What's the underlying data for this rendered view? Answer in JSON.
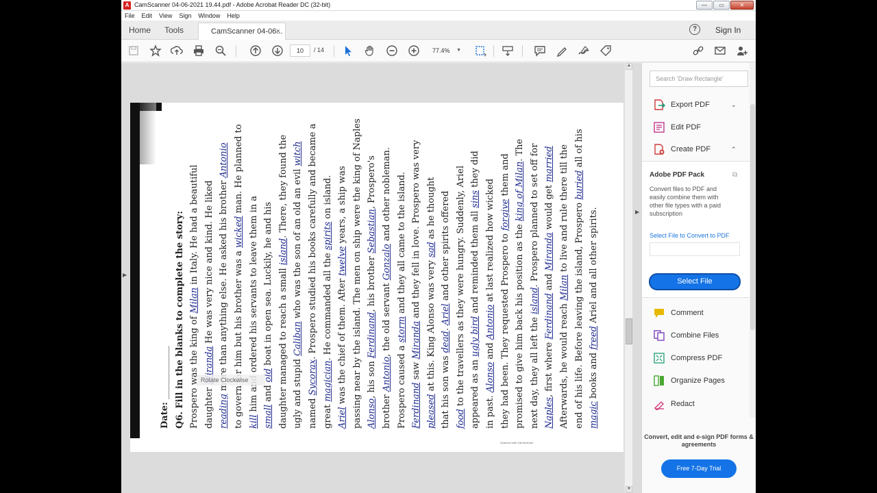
{
  "window": {
    "title": "CamScanner 04-06-2021 19.44.pdf - Adobe Acrobat Reader DC (32-bit)",
    "app_icon_letter": "A",
    "controls": {
      "minimize": "—",
      "maximize": "▭",
      "close": "✕"
    }
  },
  "menu": {
    "items": [
      "File",
      "Edit",
      "View",
      "Sign",
      "Window",
      "Help"
    ]
  },
  "tabs": {
    "home": "Home",
    "tools": "Tools",
    "document": "CamScanner 04-06...",
    "close": "×",
    "help": "?",
    "sign_in": "Sign In"
  },
  "toolbar": {
    "page_current": "10",
    "page_total": "/ 14",
    "zoom": "77.4%",
    "zoom_dropdown": "▼"
  },
  "document": {
    "date_label": "Date:",
    "question": "Q6. Fill in the blanks to complete the story:",
    "lines": [
      [
        "Prospero was the king of ",
        "Milan",
        " in Italy. He had a beautiful"
      ],
      [
        "daughter ",
        "Miranda",
        " He was very nice and kind. He liked"
      ],
      [
        "",
        "reading",
        " more than anything else. He asked his brother ",
        "Antonio",
        ""
      ],
      [
        "to govern for him but his brother was a ",
        "wicked",
        " man. He planned to"
      ],
      [
        "",
        "kill",
        " him and ordered his servants to leave them in a"
      ],
      [
        "",
        "small",
        " and ",
        "old",
        " boat in open sea. Luckily, he and his"
      ],
      [
        "daughter managed to reach a small ",
        "island",
        ". There, they found the"
      ],
      [
        "ugly and stupid ",
        "Caliban",
        " who was the son of an old an evil ",
        "witch",
        ""
      ],
      [
        "named ",
        "Sycorax",
        ". Prospero studied his books carefully and became a"
      ],
      [
        "great ",
        "magician",
        ". He commanded all the ",
        "spirits",
        " on island."
      ],
      [
        "",
        "Ariel",
        " was the chief of them. After ",
        "twelve",
        " years, a ship was"
      ],
      [
        "passing near by the island. The men on ship were the king of Naples"
      ],
      [
        "",
        "Alonso",
        ", his son ",
        "Ferdinand",
        ", his brother ",
        "Sebastian",
        ", Prospero's"
      ],
      [
        "brother ",
        "Antonio",
        ", the old servant ",
        "Gonzalo",
        " and other nobleman."
      ],
      [
        "Prospero caused a ",
        "storm",
        " and they all came to the island."
      ],
      [
        "",
        "Ferdinand",
        " saw ",
        "Miranda",
        " and they fell in love. Prospero was very"
      ],
      [
        "",
        "pleased",
        " at this. King Alonso was very ",
        "sad",
        " as he thought"
      ],
      [
        "that his son was ",
        "dead",
        ". ",
        "Ariel",
        " and other spirits offered"
      ],
      [
        "",
        "food",
        " to the travellers as they were hungry. Suddenly, Ariel"
      ],
      [
        "appeared as an ",
        "ugly bird",
        " and reminded them all ",
        "sins",
        " they did"
      ],
      [
        "in past. ",
        "Alonso",
        " and ",
        "Antonio",
        " at last realized how wicked"
      ],
      [
        "they had been. They requested Prospero to ",
        "forgive",
        " them and"
      ],
      [
        "promised to give him back his position as the ",
        "king of Milan",
        ". The"
      ],
      [
        "next day, they all left the ",
        "island",
        ". Prospero planned to set off for"
      ],
      [
        "",
        "Naples",
        ", first where ",
        "Ferdinand",
        " and ",
        "Miranda",
        " would get ",
        "married",
        ""
      ],
      [
        "Afterwards, he would reach ",
        "Milan",
        " to live and rule there till the"
      ],
      [
        "end of his life. Before leaving the island, Prospero ",
        "buried",
        " all of his"
      ],
      [
        "",
        "magic",
        " books and ",
        "freed",
        " Ariel and all other spirits."
      ]
    ],
    "scanned_with": "Scanned with CamScanner",
    "rotate_tip": "Rotate Clockwise"
  },
  "right_pane": {
    "search_placeholder": "Search 'Draw Rectangle'",
    "tools": [
      {
        "label": "Export PDF",
        "chevron": "⌄",
        "color": "#d13a3a"
      },
      {
        "label": "Edit PDF",
        "color": "#c2378c"
      },
      {
        "label": "Create PDF",
        "chevron": "⌃",
        "color": "#d13a3a"
      },
      {
        "label": "Comment",
        "color": "#e6b800"
      },
      {
        "label": "Combine Files",
        "color": "#7b3fbf"
      },
      {
        "label": "Compress PDF",
        "color": "#2aa57a"
      },
      {
        "label": "Organize Pages",
        "color": "#4aa832"
      },
      {
        "label": "Redact",
        "color": "#d13a7a"
      }
    ],
    "pack": {
      "title": "Adobe PDF Pack",
      "description": "Convert files to PDF and easily combine them with other file types with a paid subscription",
      "select_link": "Select File to Convert to PDF",
      "select_button": "Select File"
    },
    "promo": "Convert, edit and e-sign PDF forms & agreements",
    "trial_button": "Free 7-Day Trial"
  }
}
